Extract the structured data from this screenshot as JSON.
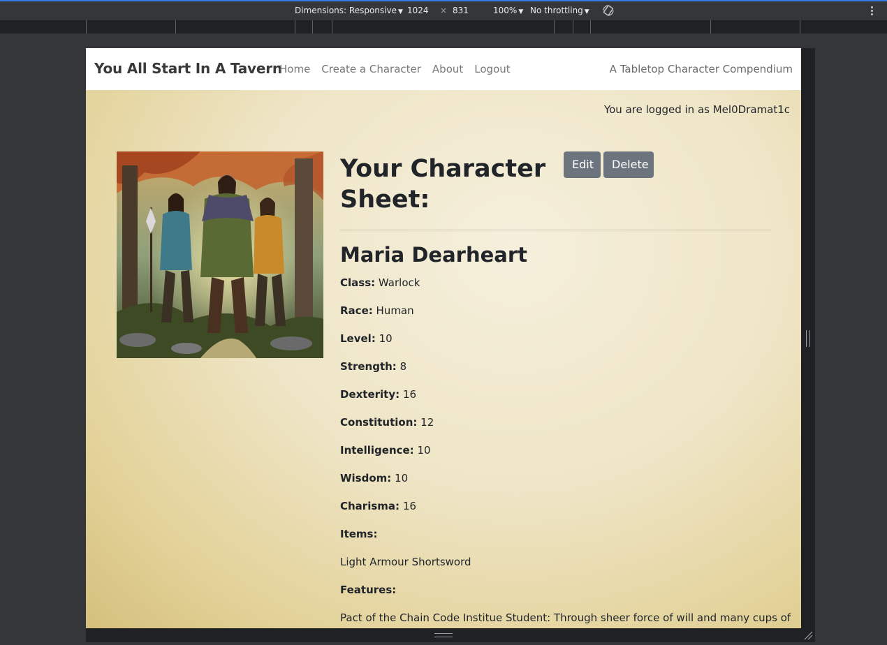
{
  "devtools": {
    "dimensions_label": "Dimensions: Responsive",
    "width": "1024",
    "times": "×",
    "height": "831",
    "zoom": "100%",
    "throttling": "No throttling"
  },
  "navbar": {
    "brand": "You All Start In A Tavern",
    "links": [
      "Home",
      "Create a Character",
      "About",
      "Logout"
    ],
    "tagline": "A Tabletop Character Compendium"
  },
  "login_status": "You are logged in as Mel0Dramat1c",
  "sheet": {
    "title": "Your Character Sheet:",
    "edit_label": "Edit",
    "delete_label": "Delete",
    "character_name": "Maria Dearheart",
    "stats": [
      {
        "label": "Class:",
        "value": "Warlock"
      },
      {
        "label": "Race:",
        "value": "Human"
      },
      {
        "label": "Level:",
        "value": "10"
      },
      {
        "label": "Strength:",
        "value": "8"
      },
      {
        "label": "Dexterity:",
        "value": "16"
      },
      {
        "label": "Constitution:",
        "value": "12"
      },
      {
        "label": "Intelligence:",
        "value": "10"
      },
      {
        "label": "Wisdom:",
        "value": "10"
      },
      {
        "label": "Charisma:",
        "value": "16"
      }
    ],
    "items_label": "Items:",
    "items_value": "Light Armour Shortsword",
    "features_label": "Features:",
    "features_value": "Pact of the Chain Code Institue Student: Through sheer force of will and many cups of"
  }
}
